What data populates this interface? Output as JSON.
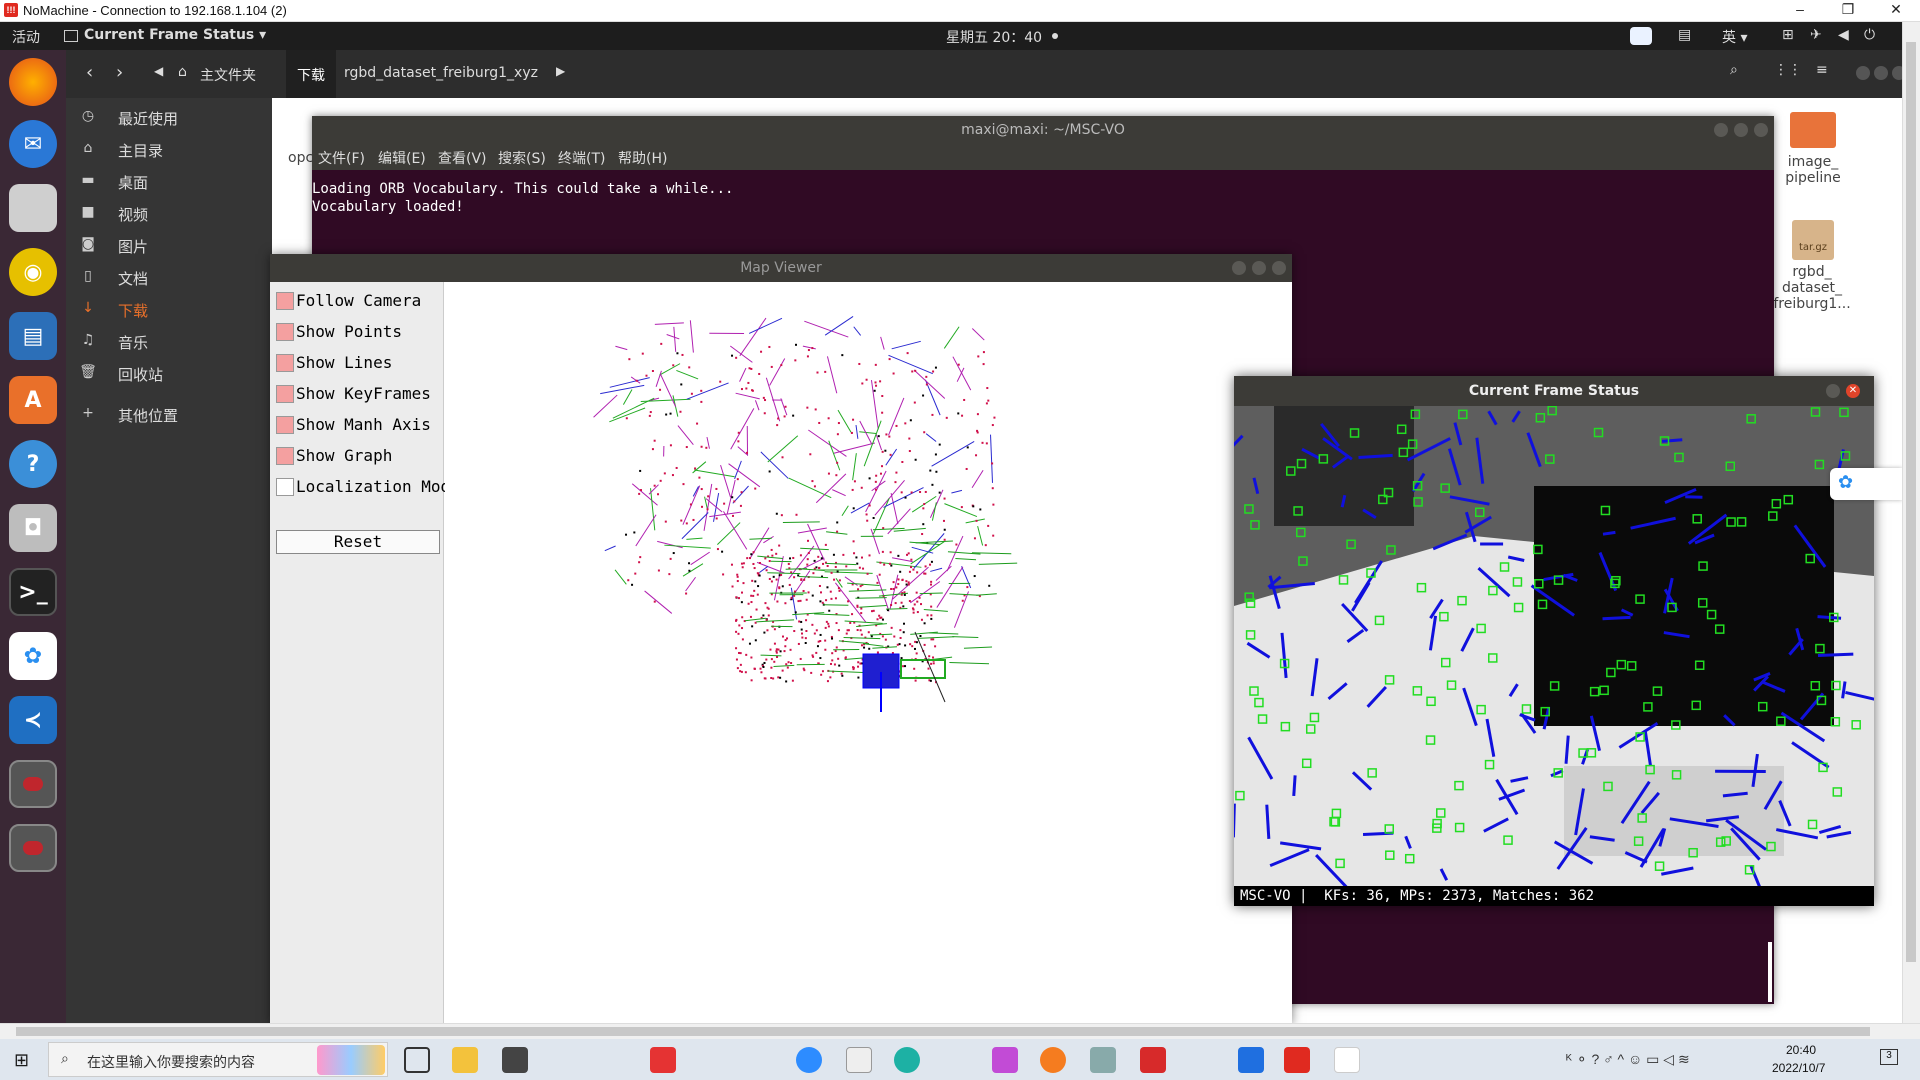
{
  "nomachine": {
    "title": "NoMachine - Connection to 192.168.1.104 (2)"
  },
  "topbar": {
    "activities": "活动",
    "app_menu": "Current Frame Status ▾",
    "clock": "星期五 20：40",
    "input_method": "英 ▾"
  },
  "files": {
    "path": [
      "主文件夹",
      "下载",
      "rgbd_dataset_freiburg1_xyz"
    ],
    "sidebar": [
      {
        "icon": "clock-icon",
        "label": "最近使用"
      },
      {
        "icon": "home-icon",
        "label": "主目录"
      },
      {
        "icon": "folder-icon",
        "label": "桌面"
      },
      {
        "icon": "video-icon",
        "label": "视频"
      },
      {
        "icon": "camera-icon",
        "label": "图片"
      },
      {
        "icon": "document-icon",
        "label": "文档"
      },
      {
        "icon": "download-icon",
        "label": "下载"
      },
      {
        "icon": "music-icon",
        "label": "音乐"
      },
      {
        "icon": "trash-icon",
        "label": "回收站"
      },
      {
        "icon": "plus-icon",
        "label": "其他位置"
      }
    ],
    "items": [
      {
        "name": "image_\npipeline",
        "icon": "folder-icon"
      },
      {
        "name": "rgbd_\ndataset_\nfreiburg1...",
        "icon": "archive-icon",
        "badge": "tar.gz"
      }
    ],
    "partial_label": "opc"
  },
  "terminal": {
    "title": "maxi@maxi: ~/MSC-VO",
    "menu": [
      "文件(F)",
      "编辑(E)",
      "查看(V)",
      "搜索(S)",
      "终端(T)",
      "帮助(H)"
    ],
    "lines": [
      "Loading ORB Vocabulary. This could take a while...",
      "Vocabulary loaded!"
    ]
  },
  "map_viewer": {
    "title": "Map Viewer",
    "options": [
      {
        "label": "Follow Camera",
        "checked": true
      },
      {
        "label": "Show Points",
        "checked": true
      },
      {
        "label": "Show Lines",
        "checked": true
      },
      {
        "label": "Show KeyFrames",
        "checked": true
      },
      {
        "label": "Show Manh Axis",
        "checked": true
      },
      {
        "label": "Show Graph",
        "checked": true
      },
      {
        "label": "Localization Mode",
        "checked": false
      }
    ],
    "reset_label": "Reset"
  },
  "frame_status": {
    "title": "Current Frame Status",
    "status_line": "MSC-VO |  KFs: 36, MPs: 2373, Matches: 362"
  },
  "taskbar": {
    "search_placeholder": "在这里输入你要搜索的内容",
    "time": "20:40",
    "date": "2022/10/7",
    "notification_count": "3"
  },
  "colors": {
    "terminal_bg": "#300a24",
    "checkbox_checked": "#f4a0a0",
    "feature_green": "#22dd22",
    "line_blue": "#1010dd",
    "map_point_red": "#d0104a",
    "keyframe_blue": "#1f1fd0"
  }
}
